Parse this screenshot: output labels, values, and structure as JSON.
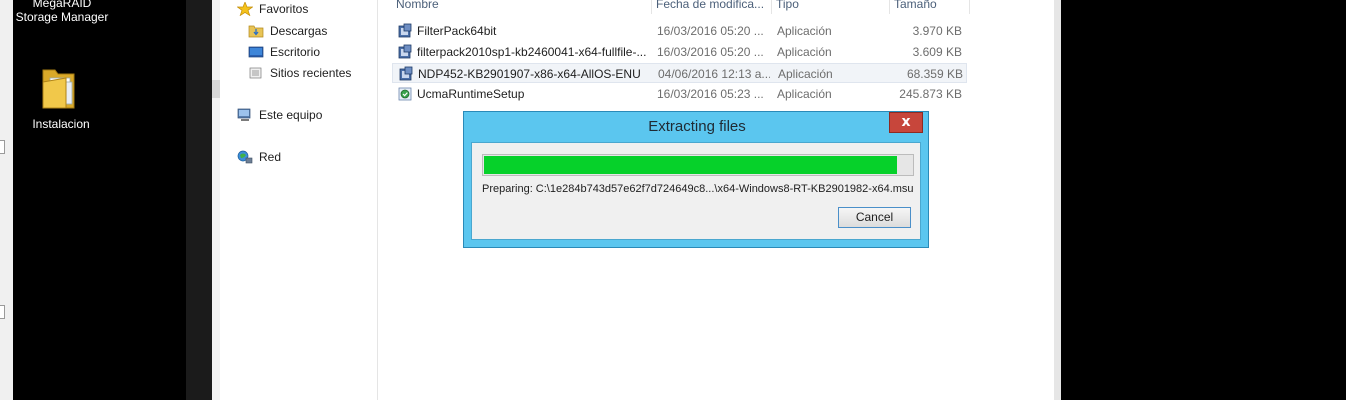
{
  "desktop": {
    "icons": [
      {
        "label": "MegaRAID\nStorage Manager",
        "icon": "megaraid-icon"
      },
      {
        "label": "Instalacion",
        "icon": "folder-icon"
      }
    ]
  },
  "navigation": {
    "items": [
      {
        "label": "Favoritos",
        "icon": "star-icon"
      },
      {
        "label": "Descargas",
        "icon": "downloads-folder-icon"
      },
      {
        "label": "Escritorio",
        "icon": "desktop-icon"
      },
      {
        "label": "Sitios recientes",
        "icon": "recent-places-icon"
      },
      {
        "label": "Este equipo",
        "icon": "computer-icon"
      },
      {
        "label": "Red",
        "icon": "network-icon"
      }
    ]
  },
  "file_list": {
    "columns": [
      "Nombre",
      "Fecha de modifica...",
      "Tipo",
      "Tamaño"
    ],
    "rows": [
      {
        "name": "FilterPack64bit",
        "date": "16/03/2016 05:20 ...",
        "type": "Aplicación",
        "size": "3.970 KB",
        "icon": "installer-icon"
      },
      {
        "name": "filterpack2010sp1-kb2460041-x64-fullfile-...",
        "date": "16/03/2016 05:20 ...",
        "type": "Aplicación",
        "size": "3.609 KB",
        "icon": "installer-icon"
      },
      {
        "name": "NDP452-KB2901907-x86-x64-AllOS-ENU",
        "date": "04/06/2016 12:13 a...",
        "type": "Aplicación",
        "size": "68.359 KB",
        "icon": "installer-icon"
      },
      {
        "name": "UcmaRuntimeSetup",
        "date": "16/03/2016 05:23 ...",
        "type": "Aplicación",
        "size": "245.873 KB",
        "icon": "setup-icon"
      }
    ],
    "selected_row": 2
  },
  "dialog": {
    "title": "Extracting files",
    "close_symbol": "x",
    "progress_fraction": 0.965,
    "status_text": "Preparing: C:\\1e284b743d57e62f7d724649c8...\\x64-Windows8-RT-KB2901982-x64.msu",
    "cancel_label": "Cancel"
  },
  "colors": {
    "dialog_frame": "#5bc6ef",
    "progress_fill": "#06d12a",
    "close_button": "#c7463b"
  }
}
